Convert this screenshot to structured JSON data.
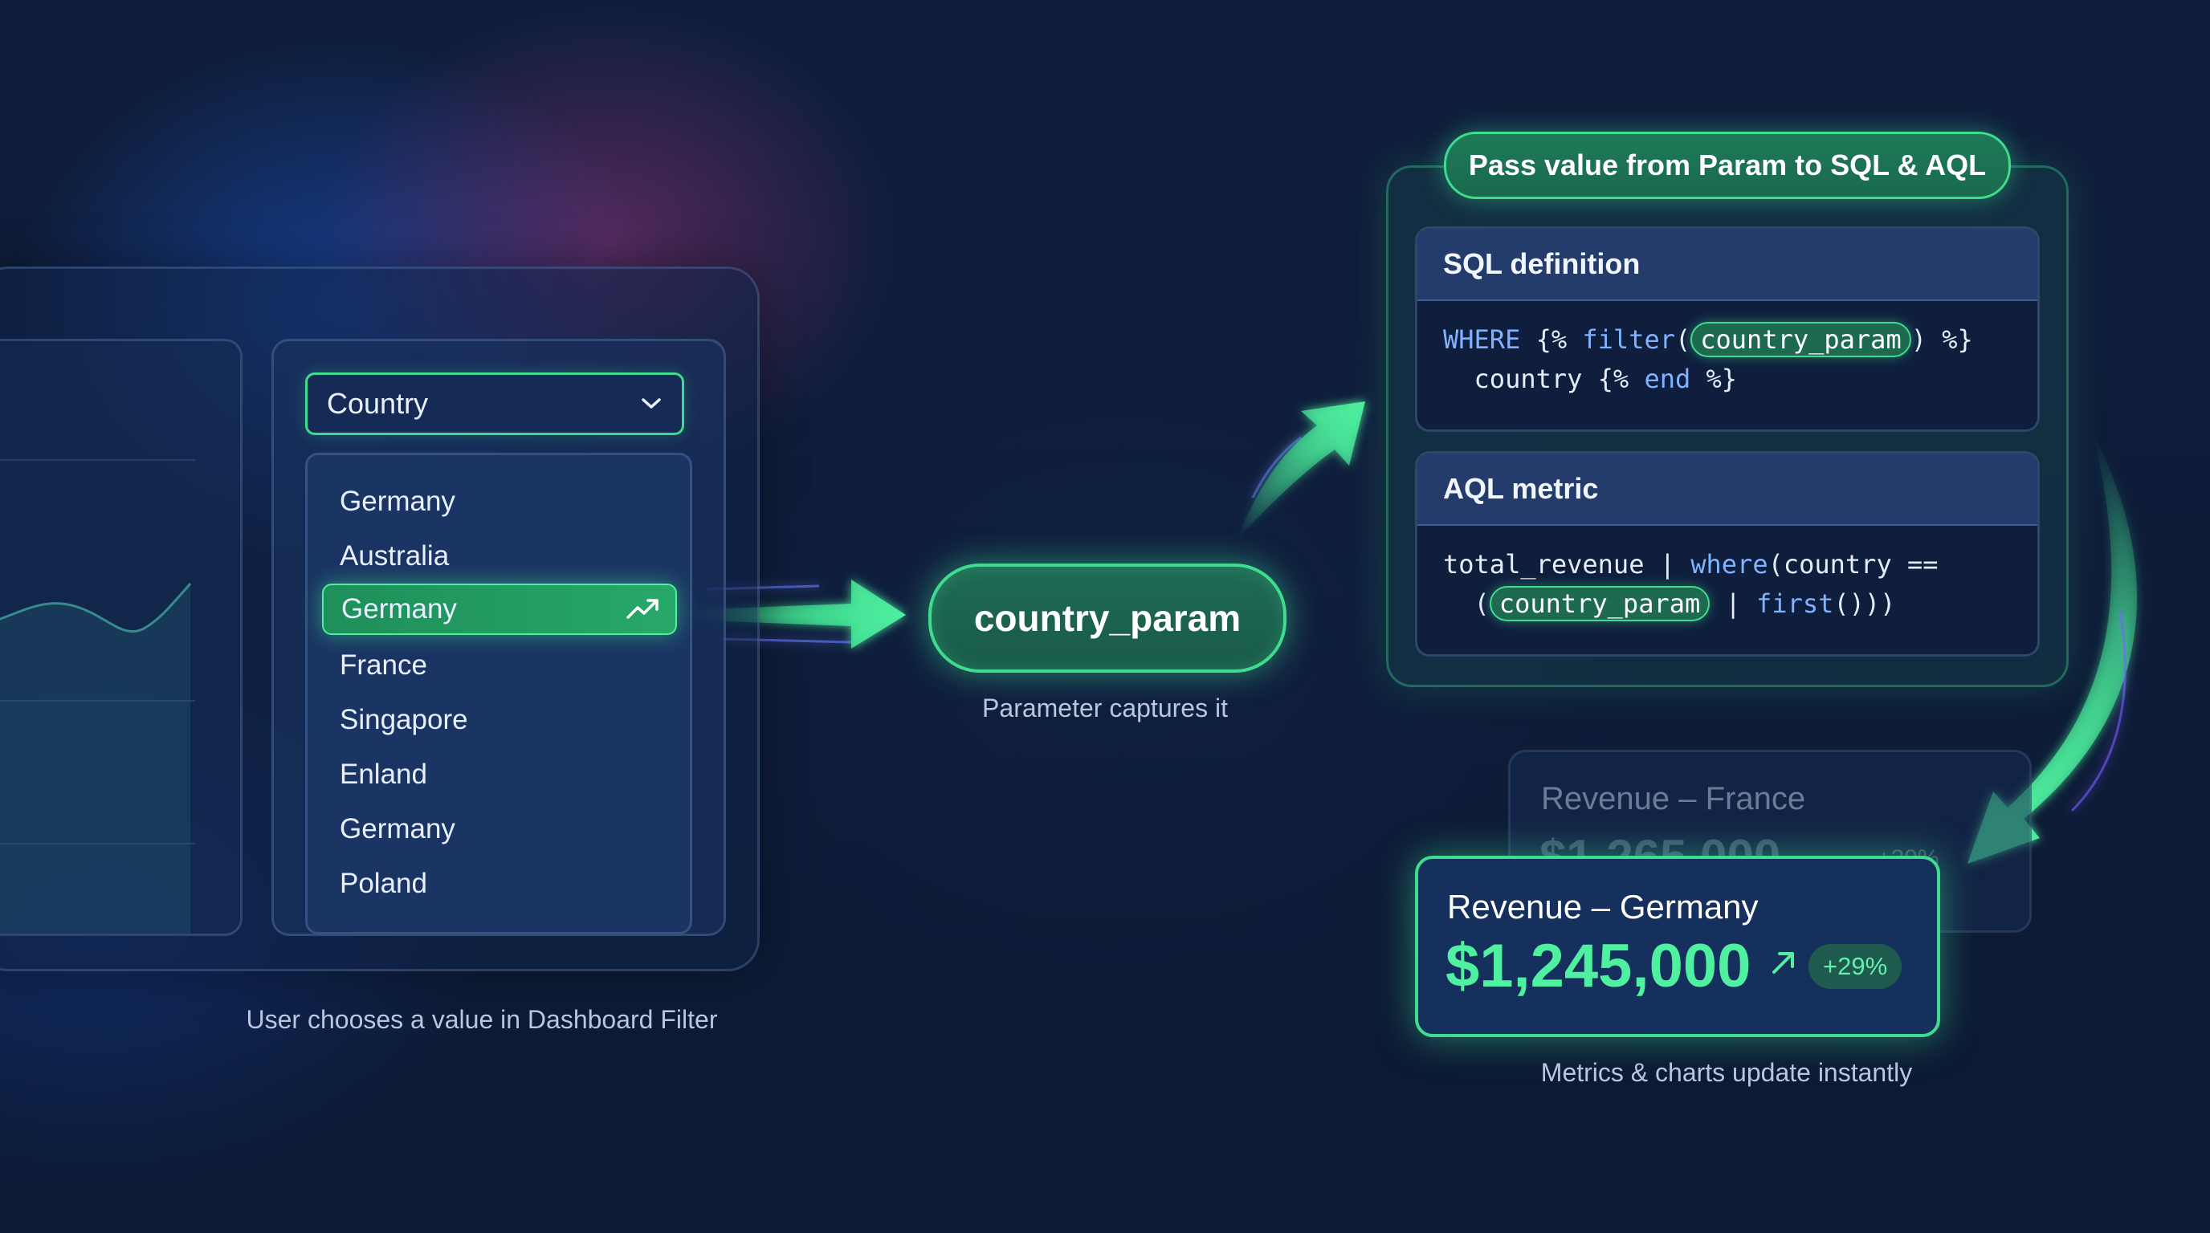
{
  "filter": {
    "select_label": "Country",
    "options": [
      "Germany",
      "Australia",
      "Germany",
      "France",
      "Singapore",
      "Enland",
      "Germany",
      "Poland"
    ],
    "selected_index": 2,
    "caption": "User chooses a value in Dashboard Filter"
  },
  "parameter": {
    "name": "country_param",
    "caption": "Parameter captures it"
  },
  "pass_panel": {
    "title": "Pass value from Param to SQL & AQL",
    "sql": {
      "title": "SQL definition",
      "line1_kw1": "WHERE",
      "line1_t1": " {% ",
      "line1_kw2": "filter",
      "line1_t2": "(",
      "line1_chip": "country_param",
      "line1_t3": ") %}",
      "line2_t1": "  country {% ",
      "line2_kw1": "end",
      "line2_t2": " %}"
    },
    "aql": {
      "title": "AQL metric",
      "line1_t1": "total_revenue | ",
      "line1_kw1": "where",
      "line1_t2": "(country ==",
      "line2_t1": "  (",
      "line2_chip": "country_param",
      "line2_t2": " | ",
      "line2_kw1": "first",
      "line2_t3": "()))"
    }
  },
  "revenue_previous": {
    "title": "Revenue – France",
    "value": "$1,265,000",
    "delta": "+29%"
  },
  "revenue_current": {
    "title": "Revenue – Germany",
    "value": "$1,245,000",
    "delta": "+29%"
  },
  "result_caption": "Metrics & charts update instantly",
  "colors": {
    "accent": "#3fdc8f",
    "background": "#0e1d3a",
    "keyword": "#7fb2ff"
  }
}
